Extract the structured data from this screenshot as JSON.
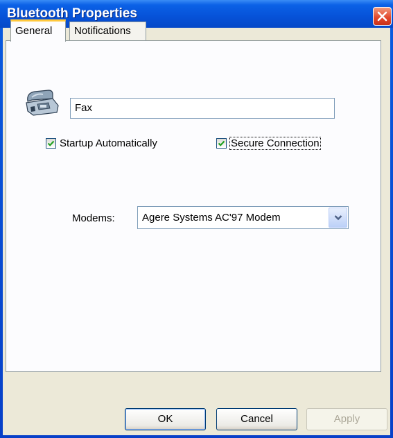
{
  "window": {
    "title": "Bluetooth Properties"
  },
  "tabs": [
    {
      "label": "General",
      "active": true
    },
    {
      "label": "Notifications",
      "active": false
    }
  ],
  "device": {
    "icon": "fax-machine-icon",
    "name_value": "Fax"
  },
  "checkboxes": {
    "startup": {
      "label": "Startup Automatically",
      "checked": true
    },
    "secure": {
      "label": "Secure Connection",
      "checked": true
    }
  },
  "modems": {
    "label": "Modems:",
    "selected": "Agere Systems AC'97 Modem"
  },
  "buttons": {
    "ok": "OK",
    "cancel": "Cancel",
    "apply": "Apply",
    "apply_enabled": false
  },
  "colors": {
    "titlebar": "#0652d8",
    "dialog_bg": "#ece9d8",
    "active_tab_accent": "#ffc83c",
    "close_button": "#e2462a"
  }
}
